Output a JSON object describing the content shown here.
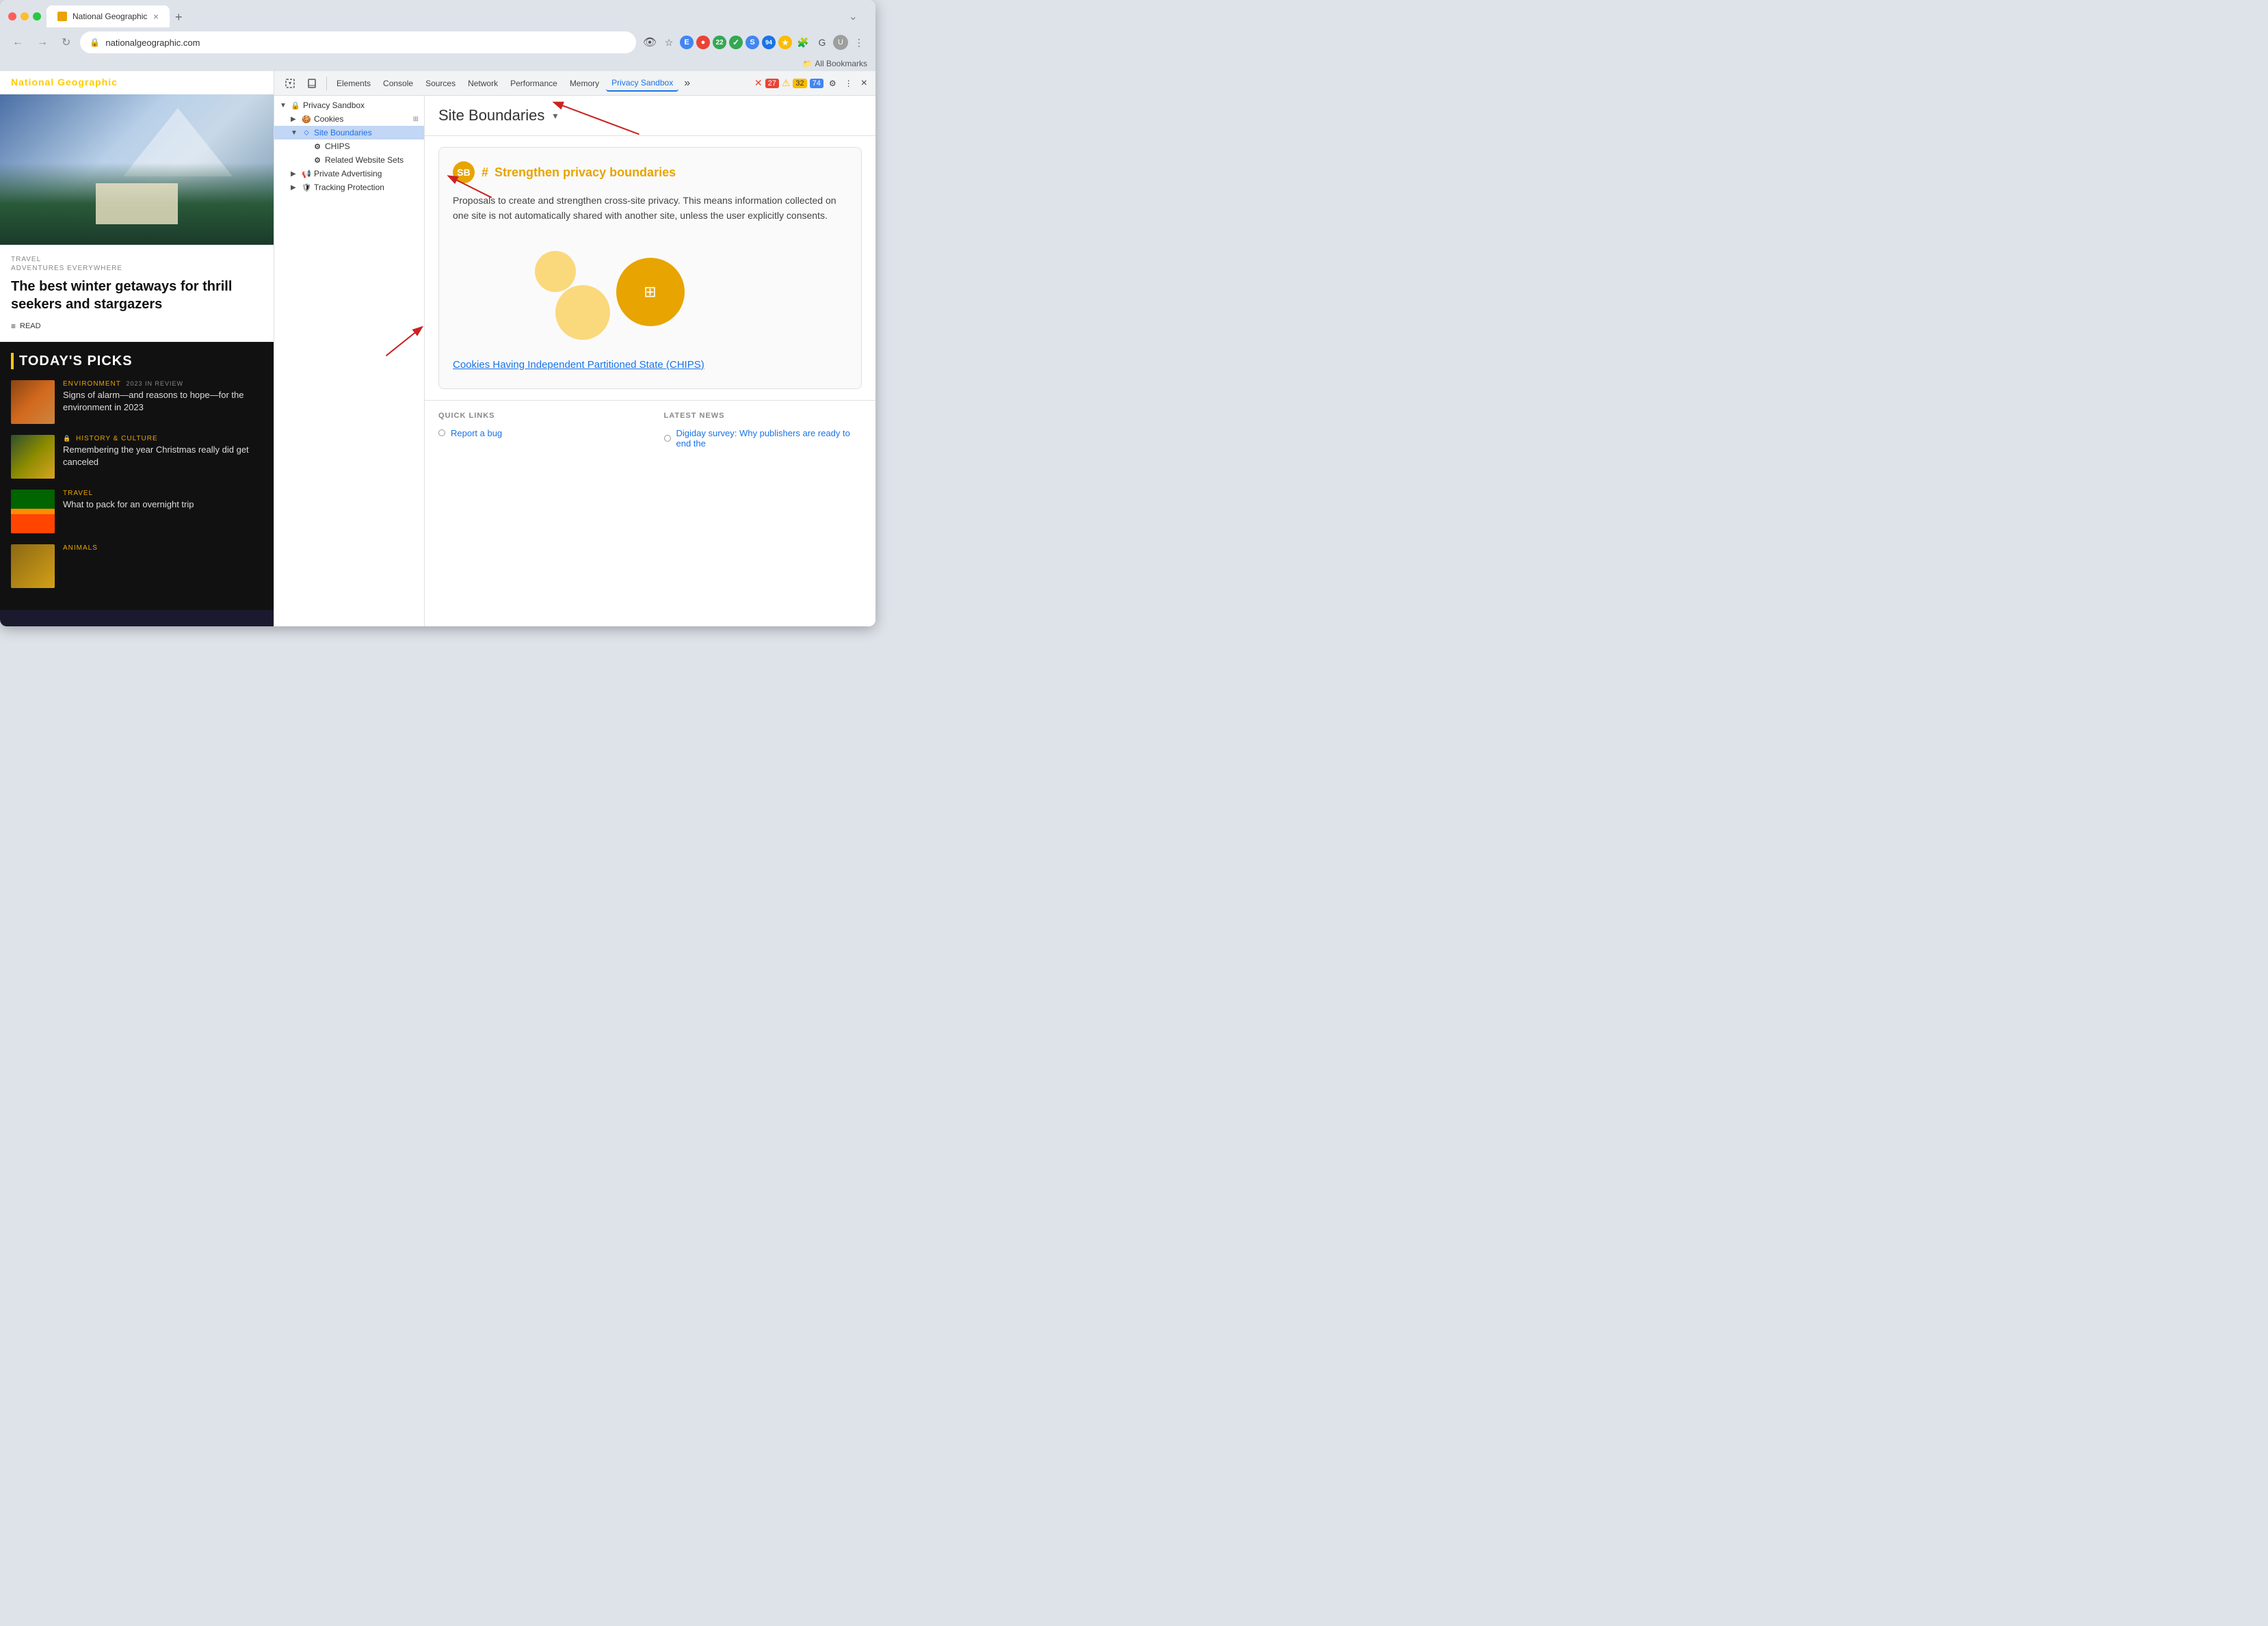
{
  "browser": {
    "tab_title": "National Geographic",
    "tab_favicon": "ng",
    "address": "nationalgeographic.com",
    "bookmarks_label": "All Bookmarks",
    "new_tab_label": "+"
  },
  "devtools": {
    "tools": [
      "Elements",
      "Console",
      "Sources",
      "Network",
      "Performance",
      "Memory",
      "Privacy Sandbox"
    ],
    "active_tool": "Privacy Sandbox",
    "more_label": "»",
    "badge_red": "27",
    "badge_warn": "32",
    "badge_blue": "74",
    "close_label": "×",
    "settings_label": "⚙",
    "more_options_label": "⋮",
    "tree": {
      "root": "Privacy Sandbox",
      "items": [
        {
          "id": "privacy-sandbox",
          "label": "Privacy Sandbox",
          "level": 0,
          "expanded": true,
          "icon": "🔒"
        },
        {
          "id": "cookies",
          "label": "Cookies",
          "level": 1,
          "expanded": false,
          "icon": "🍪"
        },
        {
          "id": "site-boundaries",
          "label": "Site Boundaries",
          "level": 1,
          "expanded": true,
          "icon": "🔷",
          "selected": true
        },
        {
          "id": "chips",
          "label": "CHIPS",
          "level": 2,
          "icon": "⚙"
        },
        {
          "id": "related-website-sets",
          "label": "Related Website Sets",
          "level": 2,
          "icon": "⚙"
        },
        {
          "id": "private-advertising",
          "label": "Private Advertising",
          "level": 1,
          "expanded": false,
          "icon": "📢"
        },
        {
          "id": "tracking-protection",
          "label": "Tracking Protection",
          "level": 1,
          "expanded": false,
          "icon": "🛡"
        }
      ]
    },
    "detail": {
      "title": "Site Boundaries",
      "dropdown_icon": "▾",
      "card": {
        "icon_label": "SB",
        "heading": "Strengthen privacy boundaries",
        "body": "Proposals to create and strengthen cross-site privacy. This means information collected on one site is not automatically shared with another site, unless the user explicitly consents.",
        "chips_link_text": "Cookies Having Independent Partitioned State (CHIPS)"
      },
      "quick_links": {
        "title": "QUICK LINKS",
        "items": [
          "Report a bug"
        ]
      },
      "latest_news": {
        "title": "LATEST NEWS",
        "items": [
          "Digiday survey: Why publishers are ready to end the"
        ]
      }
    }
  },
  "webpage": {
    "logo": "National Geographic",
    "hero_article": {
      "tag": "TRAVEL",
      "subtitle": "ADVENTURES EVERYWHERE",
      "title": "The best winter getaways for thrill seekers and stargazers",
      "read_label": "READ"
    },
    "todays_picks": {
      "header": "TODAY'S PICKS",
      "items": [
        {
          "category": "ENVIRONMENT",
          "badge": "2023 IN REVIEW",
          "description": "Signs of alarm—and reasons to hope—for the environment in 2023",
          "thumb": "env"
        },
        {
          "category": "HISTORY & CULTURE",
          "icon": "🔒",
          "description": "Remembering the year Christmas really did get canceled",
          "thumb": "hist"
        },
        {
          "category": "TRAVEL",
          "description": "What to pack for an overnight trip",
          "thumb": "travel"
        },
        {
          "category": "ANIMALS",
          "description": "",
          "thumb": "animals"
        }
      ]
    }
  }
}
